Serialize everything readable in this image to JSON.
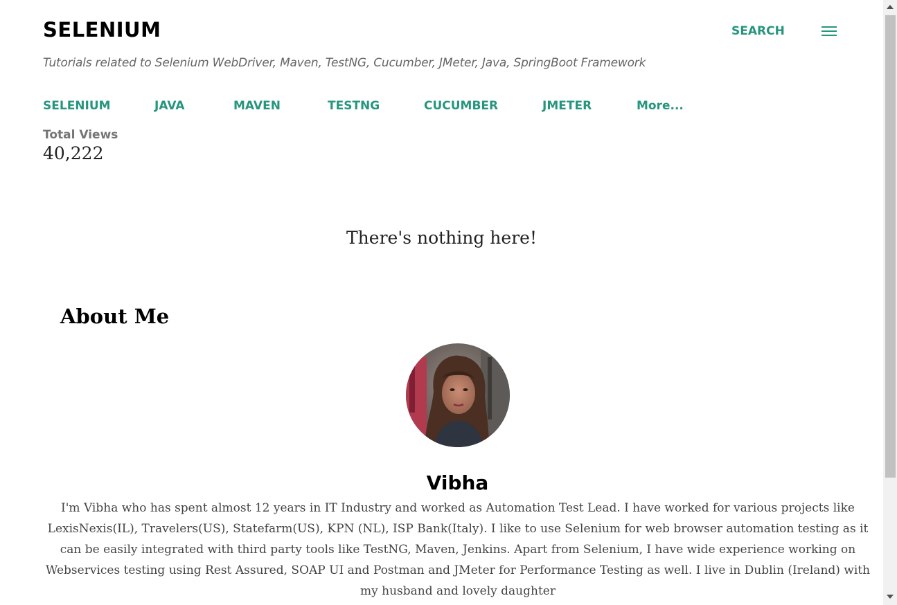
{
  "header": {
    "blog_title": "SELENIUM",
    "search_label": "SEARCH",
    "menu_icon": "hamburger-menu-icon",
    "tagline": "Tutorials related to Selenium WebDriver, Maven, TestNG, Cucumber, JMeter, Java, SpringBoot Framework"
  },
  "nav": {
    "items": [
      {
        "label": "SELENIUM"
      },
      {
        "label": "JAVA"
      },
      {
        "label": "MAVEN"
      },
      {
        "label": "TESTNG"
      },
      {
        "label": "CUCUMBER"
      },
      {
        "label": "JMETER"
      },
      {
        "label": "More..."
      }
    ]
  },
  "stats": {
    "label": "Total Views",
    "count": "40,222"
  },
  "main": {
    "empty_message": "There's nothing here!"
  },
  "about": {
    "heading": "About Me",
    "name": "Vibha",
    "bio": "I'm Vibha who has spent almost 12 years in IT Industry and worked as Automation Test Lead. I have worked for various projects like LexisNexis(IL), Travelers(US), Statefarm(US), KPN (NL), ISP Bank(Italy). I like to use Selenium for web browser automation testing as it can be easily integrated with third party tools like TestNG, Maven, Jenkins. Apart from Selenium, I have wide experience working on Webservices testing using Rest Assured, SOAP UI and Postman and JMeter for Performance Testing as well. I live in Dublin (Ireland) with my husband and lovely daughter"
  },
  "colors": {
    "accent": "#26957e",
    "text": "#212121",
    "muted": "#757575"
  }
}
